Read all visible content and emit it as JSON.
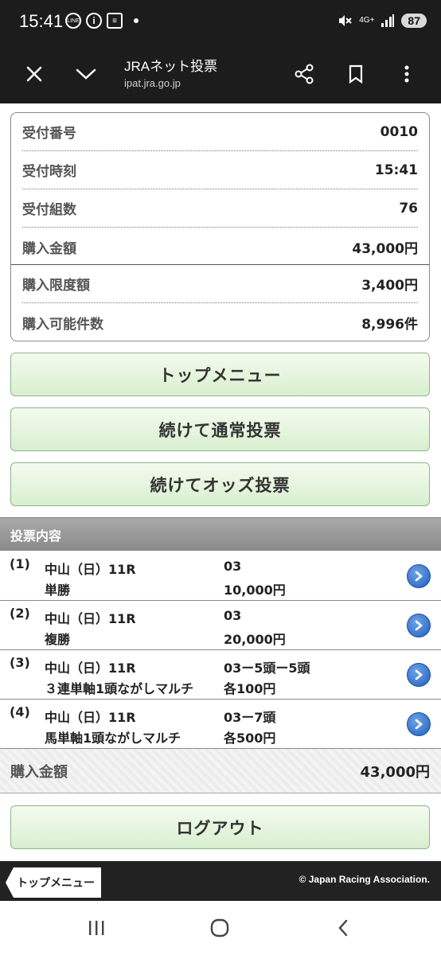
{
  "status_bar": {
    "time": "15:41",
    "network": "4G+",
    "battery": "87",
    "icons": [
      "line-icon",
      "info-icon",
      "news-icon",
      "mute-icon",
      "signal-icon"
    ]
  },
  "browser": {
    "title": "JRAネット投票",
    "url": "ipat.jra.go.jp"
  },
  "info": {
    "rows": [
      {
        "label": "受付番号",
        "value": "0010"
      },
      {
        "label": "受付時刻",
        "value": "15:41"
      },
      {
        "label": "受付組数",
        "value": "76"
      },
      {
        "label": "購入金額",
        "value": "43,000円"
      },
      {
        "label": "購入限度額",
        "value": "3,400円"
      },
      {
        "label": "購入可能件数",
        "value": "8,996件"
      }
    ]
  },
  "buttons": {
    "top_menu": "トップメニュー",
    "continue_normal": "続けて通常投票",
    "continue_odds": "続けてオッズ投票",
    "logout": "ログアウト"
  },
  "bets": {
    "header": "投票内容",
    "items": [
      {
        "index": "(1)",
        "race": "中山（日）11R",
        "type": "単勝",
        "selection": "03",
        "amount": "10,000円"
      },
      {
        "index": "(2)",
        "race": "中山（日）11R",
        "type": "複勝",
        "selection": "03",
        "amount": "20,000円"
      },
      {
        "index": "(3)",
        "race": "中山（日）11R",
        "type": "３連単軸1頭ながしマルチ",
        "selection": "03ー5頭ー5頭",
        "amount": "各100円"
      },
      {
        "index": "(4)",
        "race": "中山（日）11R",
        "type": "馬単軸1頭ながしマルチ",
        "selection": "03ー7頭",
        "amount": "各500円"
      }
    ]
  },
  "total": {
    "label": "購入金額",
    "value": "43,000円"
  },
  "footer": {
    "back_label": "トップメニュー",
    "copyright": "© Japan Racing Association."
  },
  "colors": {
    "header_bg": "#1c1c1c",
    "button_green": "#d8efcf",
    "section_gray": "#9a9a9a",
    "arrow_blue": "#1f5fbf"
  }
}
